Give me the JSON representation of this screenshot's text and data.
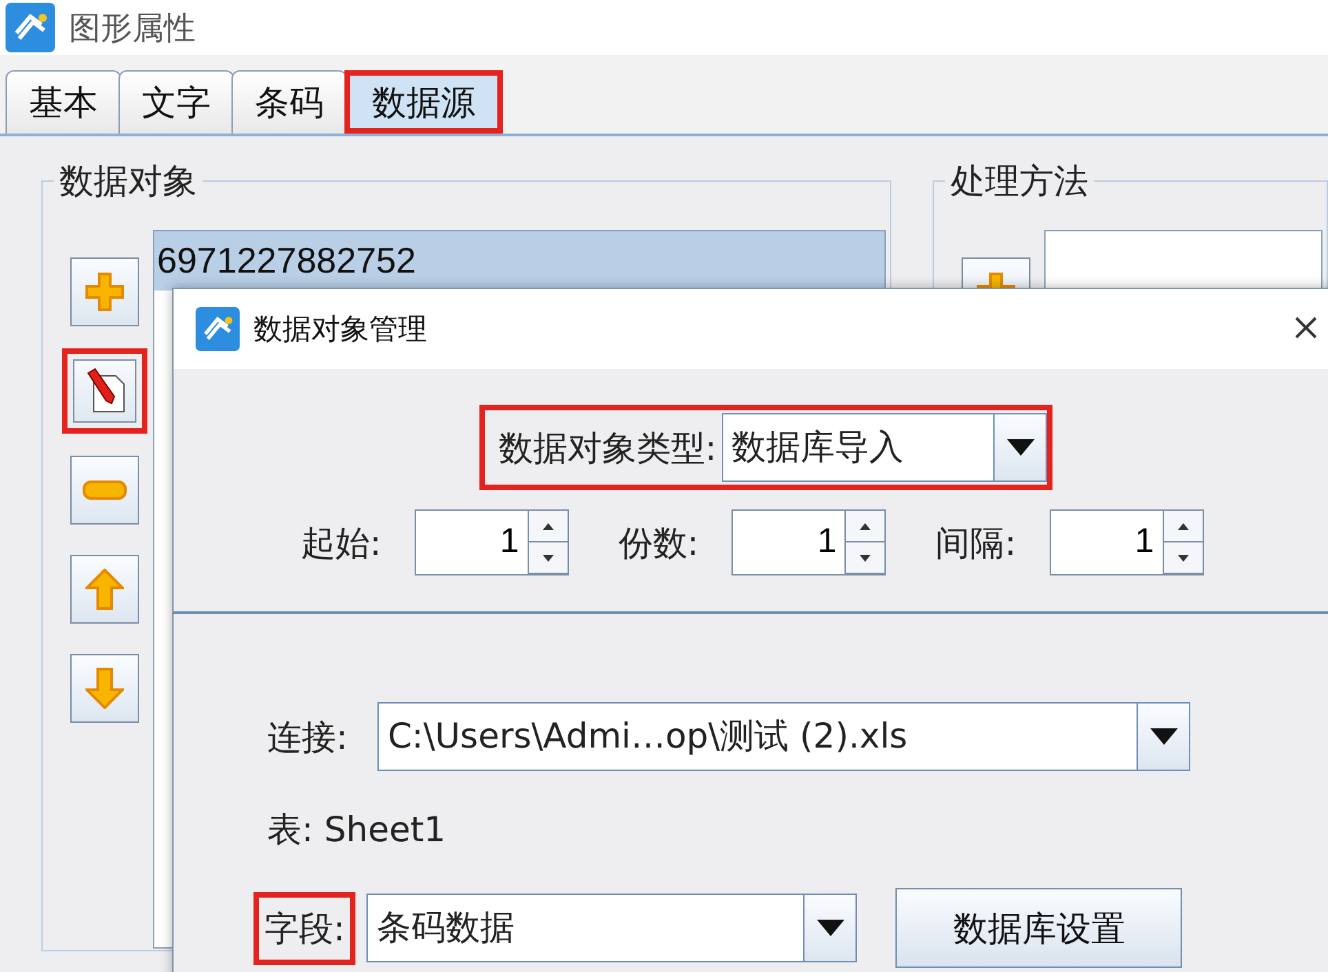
{
  "window": {
    "title": "图形属性"
  },
  "tabs": [
    {
      "label": "基本",
      "selected": false,
      "highlighted": false
    },
    {
      "label": "文字",
      "selected": false,
      "highlighted": false
    },
    {
      "label": "条码",
      "selected": false,
      "highlighted": false
    },
    {
      "label": "数据源",
      "selected": true,
      "highlighted": true
    }
  ],
  "data_objects": {
    "title": "数据对象",
    "tools": [
      {
        "kind": "add",
        "highlighted": false
      },
      {
        "kind": "edit",
        "highlighted": true
      },
      {
        "kind": "remove",
        "highlighted": false
      },
      {
        "kind": "up",
        "highlighted": false
      },
      {
        "kind": "down",
        "highlighted": false
      }
    ],
    "items": [
      {
        "text": "6971227882752",
        "selected": true
      }
    ]
  },
  "processing": {
    "title": "处理方法"
  },
  "dialog": {
    "title": "数据对象管理",
    "type": {
      "label": "数据对象类型:",
      "value": "数据库导入",
      "highlighted": true
    },
    "spinners": [
      {
        "label": "起始:",
        "value": "1"
      },
      {
        "label": "份数:",
        "value": "1"
      },
      {
        "label": "间隔:",
        "value": "1"
      }
    ],
    "connection": {
      "label": "连接:",
      "value": "C:\\Users\\Admi…op\\测试 (2).xls"
    },
    "table": {
      "label": "表:",
      "value": "Sheet1"
    },
    "field": {
      "label": "字段:",
      "value": "条码数据",
      "highlighted": true
    },
    "settings_button": "数据库设置"
  }
}
